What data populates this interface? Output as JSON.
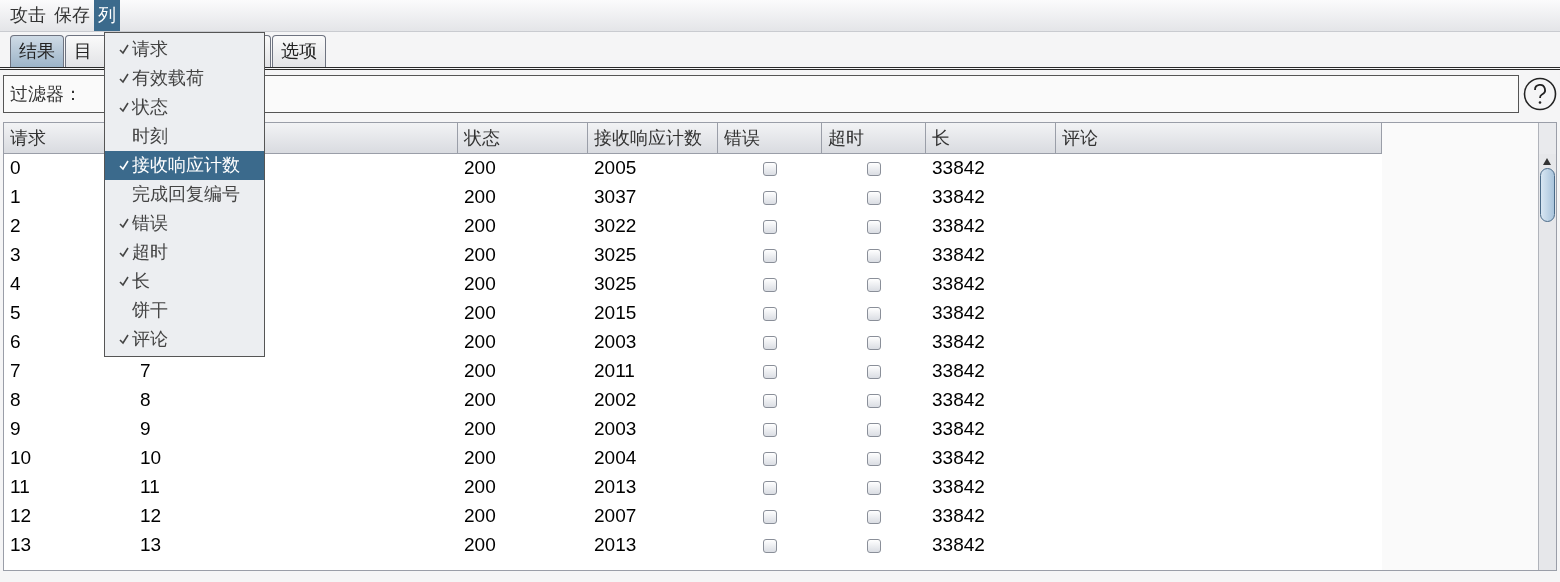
{
  "menubar": [
    {
      "label": "攻击",
      "selected": false
    },
    {
      "label": "保存",
      "selected": false
    },
    {
      "label": "列",
      "selected": true
    }
  ],
  "tabs": [
    {
      "label": "结果",
      "selected": true
    },
    {
      "label": "目",
      "selected": false
    },
    {
      "selected": false
    },
    {
      "label": "选项",
      "selected": false
    }
  ],
  "filter": {
    "label": "过滤器："
  },
  "column_menu": [
    {
      "label": "请求",
      "checked": true,
      "selected": false
    },
    {
      "label": "有效载荷",
      "checked": true,
      "selected": false
    },
    {
      "label": "状态",
      "checked": true,
      "selected": false
    },
    {
      "label": "时刻",
      "checked": false,
      "selected": false
    },
    {
      "label": "接收响应计数",
      "checked": true,
      "selected": true
    },
    {
      "label": "完成回复编号",
      "checked": false,
      "selected": false
    },
    {
      "label": "错误",
      "checked": true,
      "selected": false
    },
    {
      "label": "超时",
      "checked": true,
      "selected": false
    },
    {
      "label": "长",
      "checked": true,
      "selected": false
    },
    {
      "label": "饼干",
      "checked": false,
      "selected": false
    },
    {
      "label": "评论",
      "checked": true,
      "selected": false
    }
  ],
  "table": {
    "columns": [
      "请求",
      null,
      "状态",
      "接收响应计数",
      "错误",
      "超时",
      "长",
      "评论"
    ],
    "rows": [
      {
        "request": "0",
        "status": "200",
        "received": "2005",
        "error": false,
        "timeout": false,
        "length": "33842"
      },
      {
        "request": "1",
        "status": "200",
        "received": "3037",
        "error": false,
        "timeout": false,
        "length": "33842"
      },
      {
        "request": "2",
        "status": "200",
        "received": "3022",
        "error": false,
        "timeout": false,
        "length": "33842"
      },
      {
        "request": "3",
        "status": "200",
        "received": "3025",
        "error": false,
        "timeout": false,
        "length": "33842"
      },
      {
        "request": "4",
        "status": "200",
        "received": "3025",
        "error": false,
        "timeout": false,
        "length": "33842"
      },
      {
        "request": "5",
        "status": "200",
        "received": "2015",
        "error": false,
        "timeout": false,
        "length": "33842"
      },
      {
        "request": "6",
        "status": "200",
        "received": "2003",
        "error": false,
        "timeout": false,
        "length": "33842"
      },
      {
        "request": "7",
        "payload": "7",
        "status": "200",
        "received": "2011",
        "error": false,
        "timeout": false,
        "length": "33842"
      },
      {
        "request": "8",
        "payload": "8",
        "status": "200",
        "received": "2002",
        "error": false,
        "timeout": false,
        "length": "33842"
      },
      {
        "request": "9",
        "payload": "9",
        "status": "200",
        "received": "2003",
        "error": false,
        "timeout": false,
        "length": "33842"
      },
      {
        "request": "10",
        "payload": "10",
        "status": "200",
        "received": "2004",
        "error": false,
        "timeout": false,
        "length": "33842"
      },
      {
        "request": "11",
        "payload": "11",
        "status": "200",
        "received": "2013",
        "error": false,
        "timeout": false,
        "length": "33842"
      },
      {
        "request": "12",
        "payload": "12",
        "status": "200",
        "received": "2007",
        "error": false,
        "timeout": false,
        "length": "33842"
      },
      {
        "request": "13",
        "payload": "13",
        "status": "200",
        "received": "2013",
        "error": false,
        "timeout": false,
        "length": "33842"
      }
    ]
  }
}
